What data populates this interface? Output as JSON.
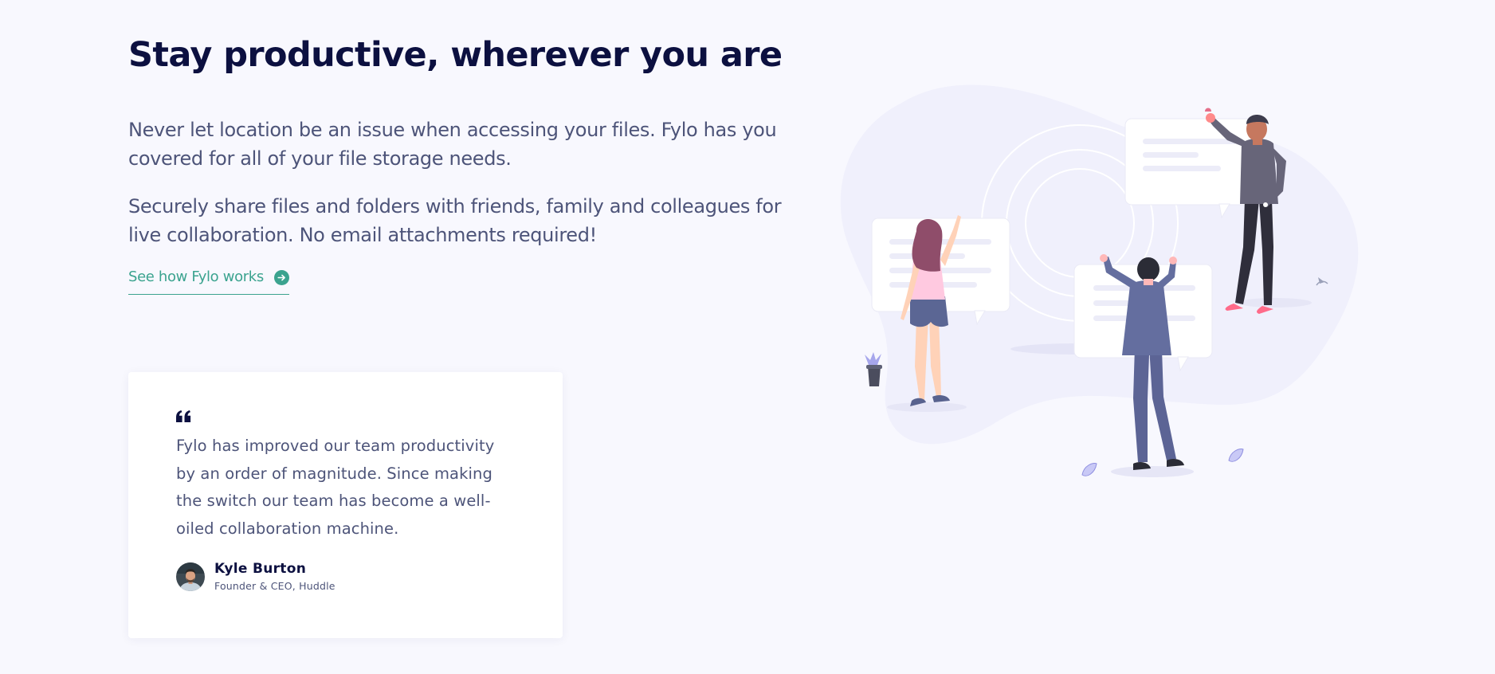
{
  "productive": {
    "title": "Stay productive, wherever you are",
    "paragraphs": [
      "Never let location be an issue when accessing your files. Fylo has you covered for all of your file storage needs.",
      "Securely share files and folders with friends, family and colleagues for live collaboration. No email attachments required!"
    ],
    "link_label": "See how Fylo works",
    "link_icon": "arrow-circle-right-icon",
    "illustration": "people-collaborating-illustration"
  },
  "testimonial": {
    "quote_icon": "quote-mark-icon",
    "quote": "Fylo has improved our team productivity by an order of magnitude. Since making the switch our team has become a well-oiled collaboration machine.",
    "author_name": "Kyle Burton",
    "author_role": "Founder & CEO, Huddle"
  },
  "colors": {
    "background": "#f8f8fe",
    "heading": "#0c1040",
    "body_text": "#4d5479",
    "accent": "#3ba38f",
    "card": "#ffffff"
  }
}
